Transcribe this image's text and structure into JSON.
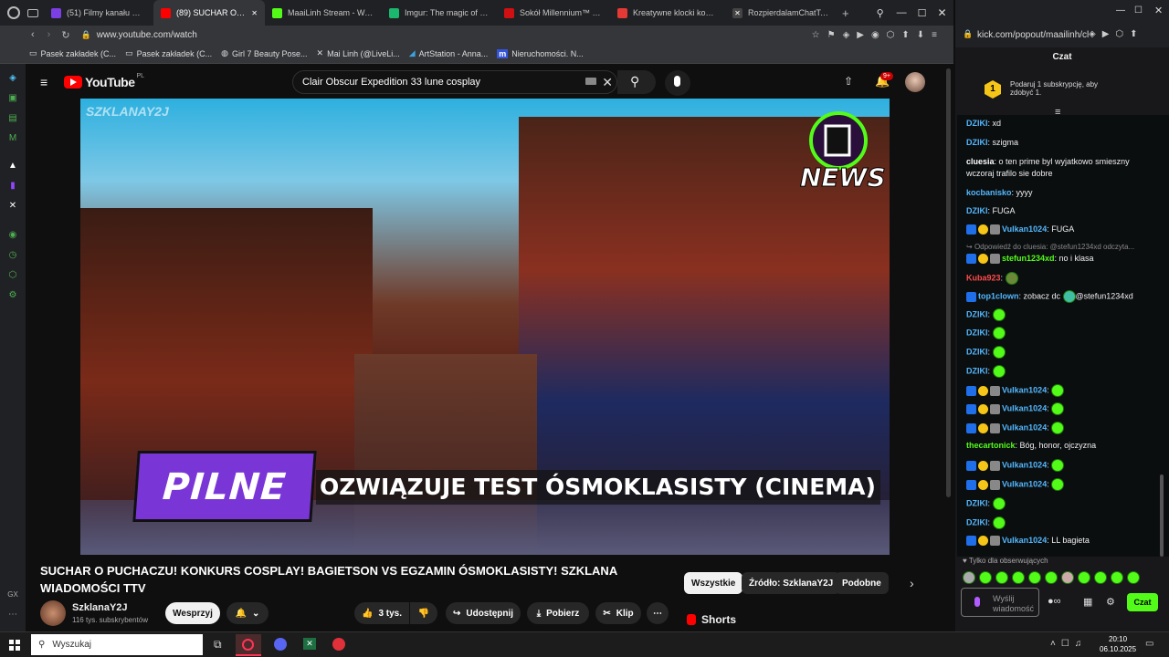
{
  "left_browser": {
    "tabs": [
      {
        "label": "(51) Filmy kanału MaaiLi",
        "color": "#7b3fe4"
      },
      {
        "label": "(89) SUCHAR O PUCH",
        "color": "#ff0000",
        "active": true
      },
      {
        "label": "MaaiLinh Stream - Watch",
        "color": "#53fc18"
      },
      {
        "label": "Imgur: The magic of the",
        "color": "#1bb76e"
      },
      {
        "label": "Sokół Millennium™ 75192",
        "color": "#d01012"
      },
      {
        "label": "Kreatywne klocki kompa",
        "color": "#e53935"
      },
      {
        "label": "RozpierdalamChatTaEmo",
        "color": "#ffffff"
      }
    ],
    "url": "www.youtube.com/watch",
    "bookmarks": [
      "Pasek zakładek (C...",
      "Pasek zakładek (C...",
      "Girl 7 Beauty Pose...",
      "Mai Linh (@LiveLi...",
      "ArtStation - Anna...",
      "Nieruchomości. N..."
    ]
  },
  "youtube": {
    "logo": "YouTube",
    "region": "PL",
    "search_value": "Clair Obscur Expedition 33 lune cosplay",
    "notif_count": "9+",
    "video": {
      "watermark": "SZKLANAY2J",
      "badge_text": "NEWS",
      "pilne_label": "PILNE",
      "ticker": "OZWIĄZUJE TEST ÓSMOKLASISTY (CINEMA)"
    },
    "title": "SUCHAR O PUCHACZU! KONKURS COSPLAY! BAGIETSON VS EGZAMIN ÓSMOKLASISTY! SZKLANA WIADOMOŚCI TTV",
    "channel": {
      "name": "SzklanaY2J",
      "subs": "116 tys. subskrybentów",
      "support_label": "Wesprzyj"
    },
    "actions": {
      "likes": "3 tys.",
      "share": "Udostępnij",
      "download": "Pobierz",
      "clip": "Klip"
    },
    "chips": [
      "Wszystkie",
      "Źródło: SzklanaY2J",
      "Podobne"
    ],
    "shorts_label": "Shorts"
  },
  "right_browser": {
    "url": "kick.com/popout/maailinh/cl",
    "chat_title": "Czat",
    "promo": "Podaruj 1 subskrypcję, aby zdobyć 1.",
    "messages": [
      {
        "user": "DZIKI",
        "color": "#53b8ff",
        "text": ": xd"
      },
      {
        "user": "DZIKI",
        "color": "#53b8ff",
        "text": ": szigma"
      },
      {
        "user": "cluesia",
        "color": "#ffffff",
        "text": ": o ten prime byl wyjatkowo smieszny"
      },
      {
        "user": "",
        "color": "#ffffff",
        "text": "wczoraj trafilo sie dobre"
      },
      {
        "user": "kocbanisko",
        "color": "#53b8ff",
        "text": ": yyyy"
      },
      {
        "user": "DZIKI",
        "color": "#53b8ff",
        "text": ": FUGA"
      },
      {
        "user": "Vulkan1024",
        "color": "#53b8ff",
        "text": ": FUGA"
      },
      {
        "user": "",
        "color": "#888888",
        "text": "Odpowiedź do cluesia: @stefun1234xd odczyta..."
      },
      {
        "user": "stefun1234xd",
        "color": "#53fc18",
        "text": ": no i klasa"
      },
      {
        "user": "Kuba923",
        "color": "#ff4a4a",
        "text": ":"
      },
      {
        "user": "top1clown",
        "color": "#53b8ff",
        "text": ": zobacz dc"
      },
      {
        "user": "DZIKI",
        "color": "#53b8ff",
        "text": ":"
      },
      {
        "user": "DZIKI",
        "color": "#53b8ff",
        "text": ":"
      },
      {
        "user": "DZIKI",
        "color": "#53b8ff",
        "text": ":"
      },
      {
        "user": "DZIKI",
        "color": "#53b8ff",
        "text": ":"
      },
      {
        "user": "Vulkan1024",
        "color": "#53b8ff",
        "text": ":"
      },
      {
        "user": "Vulkan1024",
        "color": "#53b8ff",
        "text": ":"
      },
      {
        "user": "Vulkan1024",
        "color": "#53b8ff",
        "text": ":"
      },
      {
        "user": "thecartonick",
        "color": "#53fc18",
        "text": ": Bóg, honor, ojczyzna"
      },
      {
        "user": "Vulkan1024",
        "color": "#53b8ff",
        "text": ":"
      },
      {
        "user": "Vulkan1024",
        "color": "#53b8ff",
        "text": ":"
      },
      {
        "user": "DZIKI",
        "color": "#53b8ff",
        "text": ":"
      },
      {
        "user": "DZIKI",
        "color": "#53b8ff",
        "text": ":"
      },
      {
        "user": "Vulkan1024",
        "color": "#53b8ff",
        "text": ": LL bagieta"
      }
    ],
    "mention": "@stefun1234xd",
    "followers_only": "Tylko dla obserwujących",
    "input_placeholder": "Wyślij wiadomość",
    "send_label": "Czat"
  },
  "taskbar": {
    "search_placeholder": "Wyszukaj",
    "time": "20:10",
    "date": "06.10.2025"
  }
}
